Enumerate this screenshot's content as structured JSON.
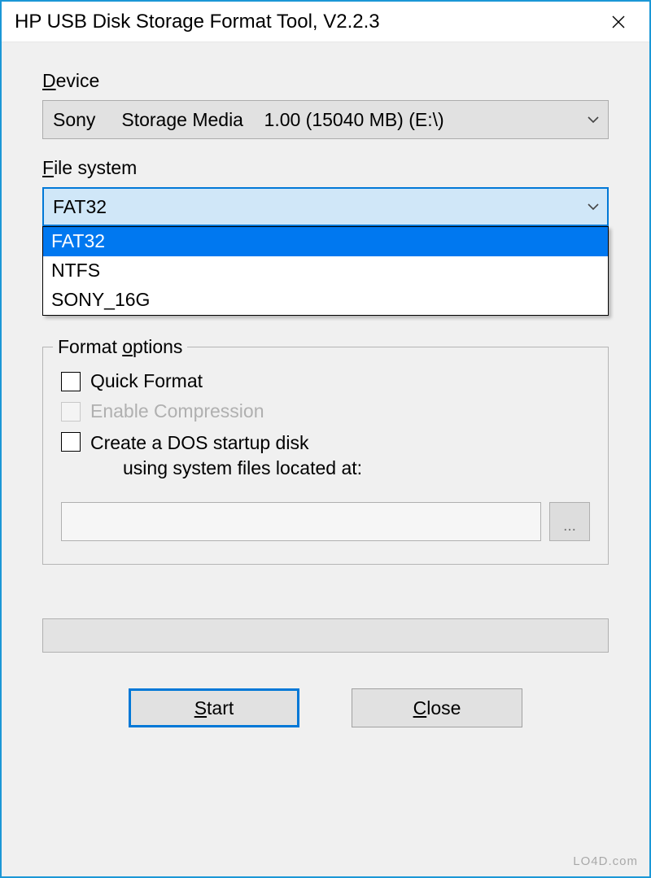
{
  "titlebar": {
    "title": "HP USB Disk Storage Format Tool, V2.2.3"
  },
  "device": {
    "label_pre": "D",
    "label_rest": "evice",
    "value": "Sony     Storage Media    1.00 (15040 MB) (E:\\)"
  },
  "filesystem": {
    "label_pre": "F",
    "label_rest": "ile system",
    "value": "FAT32",
    "options": [
      "FAT32",
      "NTFS",
      "SONY_16G"
    ],
    "selected_index": 0
  },
  "format_options": {
    "legend_rest": "Format ",
    "legend_u": "o",
    "legend_tail": "ptions",
    "quick_format": "Quick Format",
    "enable_compression": "Enable Compression",
    "dos_line1": "Create a DOS startup disk",
    "dos_line2": "using system files located at:",
    "browse": "..."
  },
  "buttons": {
    "start_u": "S",
    "start_rest": "tart",
    "close_u": "C",
    "close_rest": "lose"
  },
  "watermark": "LO4D.com"
}
